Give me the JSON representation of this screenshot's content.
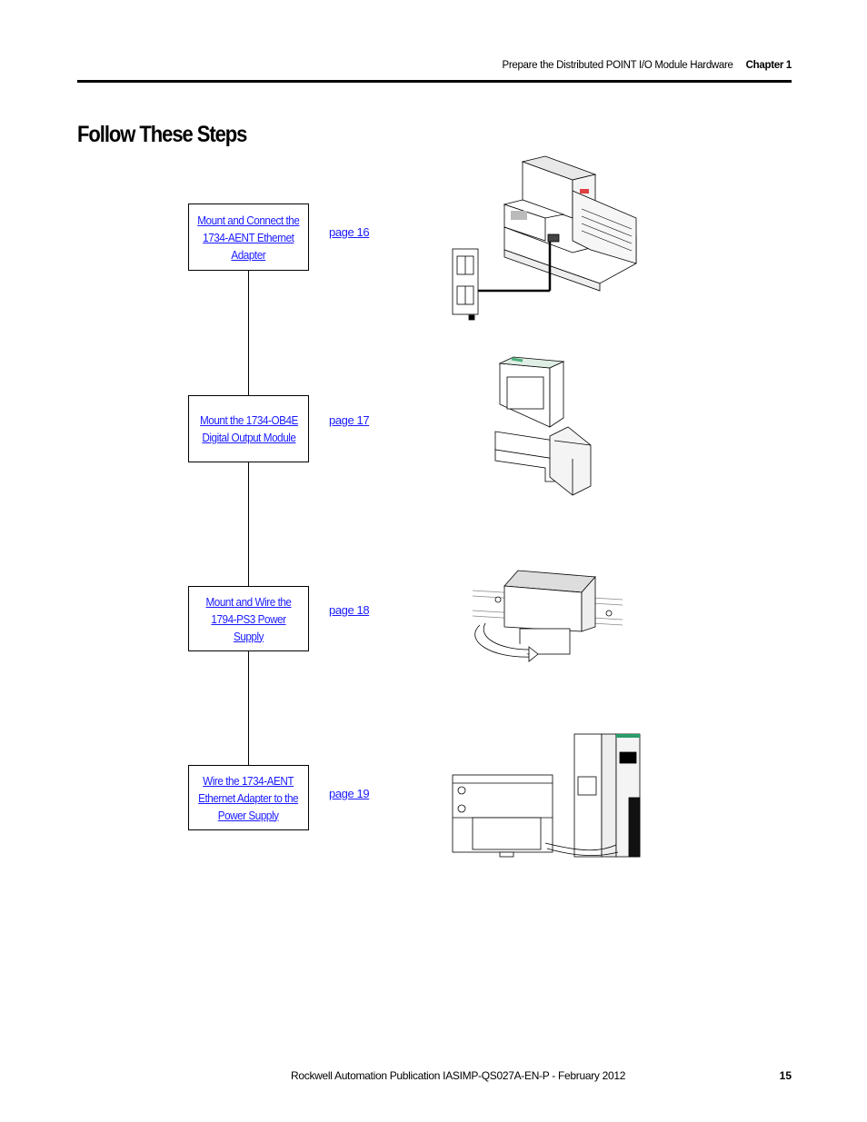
{
  "header": {
    "section_title": "Prepare the Distributed POINT I/O Module Hardware",
    "chapter_label": "Chapter 1"
  },
  "page_title": "Follow These Steps",
  "steps": [
    {
      "lines": [
        "Mount and Connect the",
        "1734-AENT Ethernet",
        "Adapter"
      ],
      "page_link": "page 16",
      "illustration": "1734-aent-adapter-with-ethernet-cable"
    },
    {
      "lines": [
        "Mount the 1734-OB4E",
        "Digital Output Module"
      ],
      "page_link": "page 17",
      "illustration": "1734-ob4e-module-and-base"
    },
    {
      "lines": [
        "Mount and Wire the",
        "1794-PS3 Power Supply"
      ],
      "page_link": "page 18",
      "illustration": "1794-ps3-power-supply-on-din-rail"
    },
    {
      "lines": [
        "Wire the 1734-AENT",
        "Ethernet Adapter to the",
        "Power Supply"
      ],
      "page_link": "page 19",
      "illustration": "power-supply-wired-to-adapter"
    }
  ],
  "colors": {
    "link": "#1a1aff",
    "text": "#000000"
  },
  "footer": {
    "publication": "Rockwell Automation Publication IASIMP-QS027A-EN-P - February 2012",
    "page_number": "15"
  }
}
